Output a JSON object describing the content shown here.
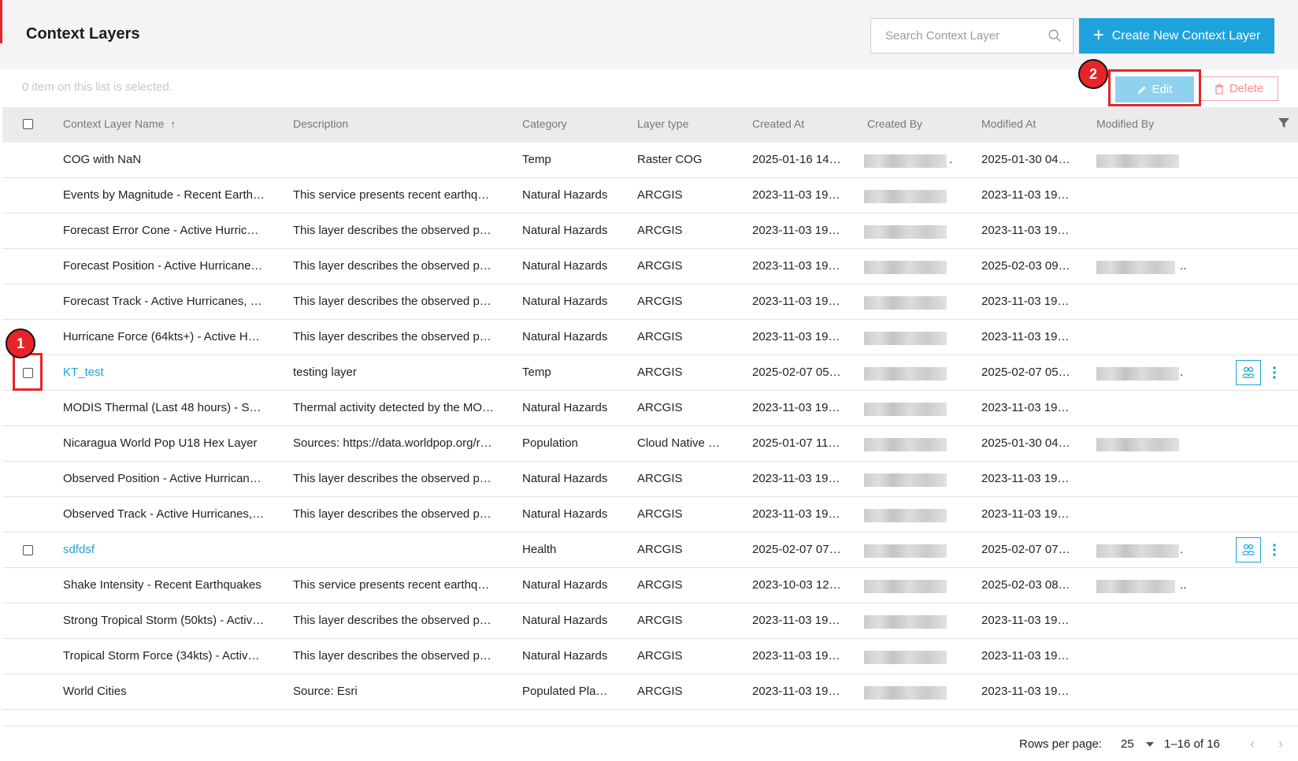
{
  "header": {
    "title": "Context Layers",
    "search_placeholder": "Search Context Layer",
    "create_label": "Create New Context Layer"
  },
  "toolbar": {
    "selection_text": "0 item on this list is selected.",
    "edit_label": "Edit",
    "delete_label": "Delete"
  },
  "annotations": [
    "1",
    "2"
  ],
  "table": {
    "columns": [
      "Context Layer Name",
      "Description",
      "Category",
      "Layer type",
      "Created At",
      "Created By",
      "Modified At",
      "Modified By"
    ],
    "rows": [
      {
        "name": "COG with NaN",
        "description": "",
        "category": "Temp",
        "layer_type": "Raster COG",
        "created_at": "2025-01-16 14…",
        "created_by_suffix": ".",
        "modified_at": "2025-01-30 04…",
        "modified_by_suffix": ""
      },
      {
        "name": "Events by Magnitude - Recent Earth…",
        "description": "This service presents recent earthq…",
        "category": "Natural Hazards",
        "layer_type": "ARCGIS",
        "created_at": "2023-11-03 19…",
        "created_by_suffix": "",
        "modified_at": "2023-11-03 19…",
        "modified_by_suffix": ""
      },
      {
        "name": "Forecast Error Cone - Active Hurric…",
        "description": "This layer describes the observed p…",
        "category": "Natural Hazards",
        "layer_type": "ARCGIS",
        "created_at": "2023-11-03 19…",
        "created_by_suffix": "",
        "modified_at": "2023-11-03 19…",
        "modified_by_suffix": ""
      },
      {
        "name": "Forecast Position - Active Hurricane…",
        "description": "This layer describes the observed p…",
        "category": "Natural Hazards",
        "layer_type": "ARCGIS",
        "created_at": "2023-11-03 19…",
        "created_by_suffix": "",
        "modified_at": "2025-02-03 09…",
        "modified_by_suffix": ".."
      },
      {
        "name": "Forecast Track - Active Hurricanes, …",
        "description": "This layer describes the observed p…",
        "category": "Natural Hazards",
        "layer_type": "ARCGIS",
        "created_at": "2023-11-03 19…",
        "created_by_suffix": "",
        "modified_at": "2023-11-03 19…",
        "modified_by_suffix": ""
      },
      {
        "name": "Hurricane Force (64kts+) - Active H…",
        "description": "This layer describes the observed p…",
        "category": "Natural Hazards",
        "layer_type": "ARCGIS",
        "created_at": "2023-11-03 19…",
        "created_by_suffix": "",
        "modified_at": "2023-11-03 19…",
        "modified_by_suffix": ""
      },
      {
        "name": "KT_test",
        "description": "testing layer",
        "category": "Temp",
        "layer_type": "ARCGIS",
        "created_at": "2025-02-07 05…",
        "created_by_suffix": "",
        "modified_at": "2025-02-07 05…",
        "modified_by_suffix": "."
      },
      {
        "name": "MODIS Thermal (Last 48 hours) - S…",
        "description": "Thermal activity detected by the MO…",
        "category": "Natural Hazards",
        "layer_type": "ARCGIS",
        "created_at": "2023-11-03 19…",
        "created_by_suffix": "",
        "modified_at": "2023-11-03 19…",
        "modified_by_suffix": ""
      },
      {
        "name": "Nicaragua World Pop U18 Hex Layer",
        "description": "Sources: https://data.worldpop.org/r…",
        "category": "Population",
        "layer_type": "Cloud Native …",
        "created_at": "2025-01-07 11…",
        "created_by_suffix": "",
        "modified_at": "2025-01-30 04…",
        "modified_by_suffix": ""
      },
      {
        "name": "Observed Position - Active Hurrican…",
        "description": "This layer describes the observed p…",
        "category": "Natural Hazards",
        "layer_type": "ARCGIS",
        "created_at": "2023-11-03 19…",
        "created_by_suffix": "",
        "modified_at": "2023-11-03 19…",
        "modified_by_suffix": ""
      },
      {
        "name": "Observed Track - Active Hurricanes,…",
        "description": "This layer describes the observed p…",
        "category": "Natural Hazards",
        "layer_type": "ARCGIS",
        "created_at": "2023-11-03 19…",
        "created_by_suffix": "",
        "modified_at": "2023-11-03 19…",
        "modified_by_suffix": ""
      },
      {
        "name": "sdfdsf",
        "description": "",
        "category": "Health",
        "layer_type": "ARCGIS",
        "created_at": "2025-02-07 07…",
        "created_by_suffix": "",
        "modified_at": "2025-02-07 07…",
        "modified_by_suffix": "."
      },
      {
        "name": "Shake Intensity - Recent Earthquakes",
        "description": "This service presents recent earthq…",
        "category": "Natural Hazards",
        "layer_type": "ARCGIS",
        "created_at": "2023-10-03 12…",
        "created_by_suffix": "",
        "modified_at": "2025-02-03 08…",
        "modified_by_suffix": ".."
      },
      {
        "name": "Strong Tropical Storm (50kts) - Activ…",
        "description": "This layer describes the observed p…",
        "category": "Natural Hazards",
        "layer_type": "ARCGIS",
        "created_at": "2023-11-03 19…",
        "created_by_suffix": "",
        "modified_at": "2023-11-03 19…",
        "modified_by_suffix": ""
      },
      {
        "name": "Tropical Storm Force (34kts) - Activ…",
        "description": "This layer describes the observed p…",
        "category": "Natural Hazards",
        "layer_type": "ARCGIS",
        "created_at": "2023-11-03 19…",
        "created_by_suffix": "",
        "modified_at": "2023-11-03 19…",
        "modified_by_suffix": ""
      },
      {
        "name": "World Cities",
        "description": "Source: Esri",
        "category": "Populated Pla…",
        "layer_type": "ARCGIS",
        "created_at": "2023-11-03 19…",
        "created_by_suffix": "",
        "modified_at": "2023-11-03 19…",
        "modified_by_suffix": ""
      }
    ]
  },
  "pagination": {
    "rows_per_page_label": "Rows per page:",
    "rows_per_page": "25",
    "range": "1–16 of 16"
  },
  "colors": {
    "accent": "#1fa3dc",
    "highlight": "#e8242b",
    "header_bg": "#f4f4f4"
  }
}
